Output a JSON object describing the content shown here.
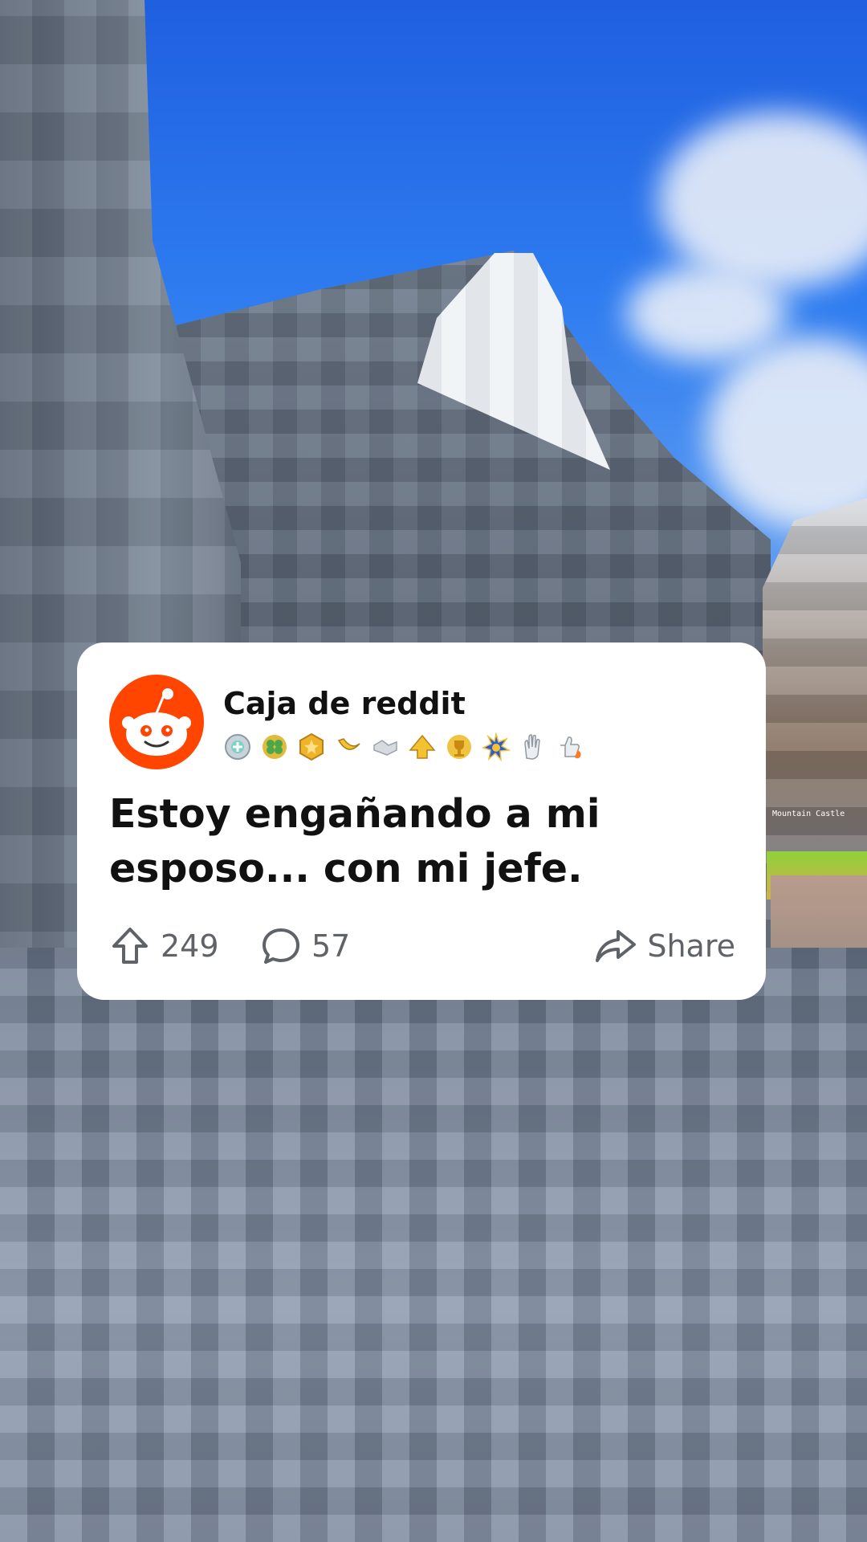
{
  "post": {
    "author": "Caja de reddit",
    "title": "Estoy engañando a mi esposo... con mi jefe.",
    "upvotes": "249",
    "comments": "57",
    "share_label": "Share"
  },
  "awards": [
    "silver-award-icon",
    "clover-award-icon",
    "gold-star-award-icon",
    "banana-award-icon",
    "handshake-award-icon",
    "up-arrow-award-icon",
    "trophy-award-icon",
    "starburst-award-icon",
    "clap-award-icon",
    "thumbs-up-fire-award-icon"
  ],
  "background": {
    "hud_text": "Mountain Castle"
  },
  "colors": {
    "reddit_orange": "#ff4500",
    "card_bg": "#ffffff",
    "text_primary": "#111111",
    "text_secondary": "#5f6368"
  }
}
